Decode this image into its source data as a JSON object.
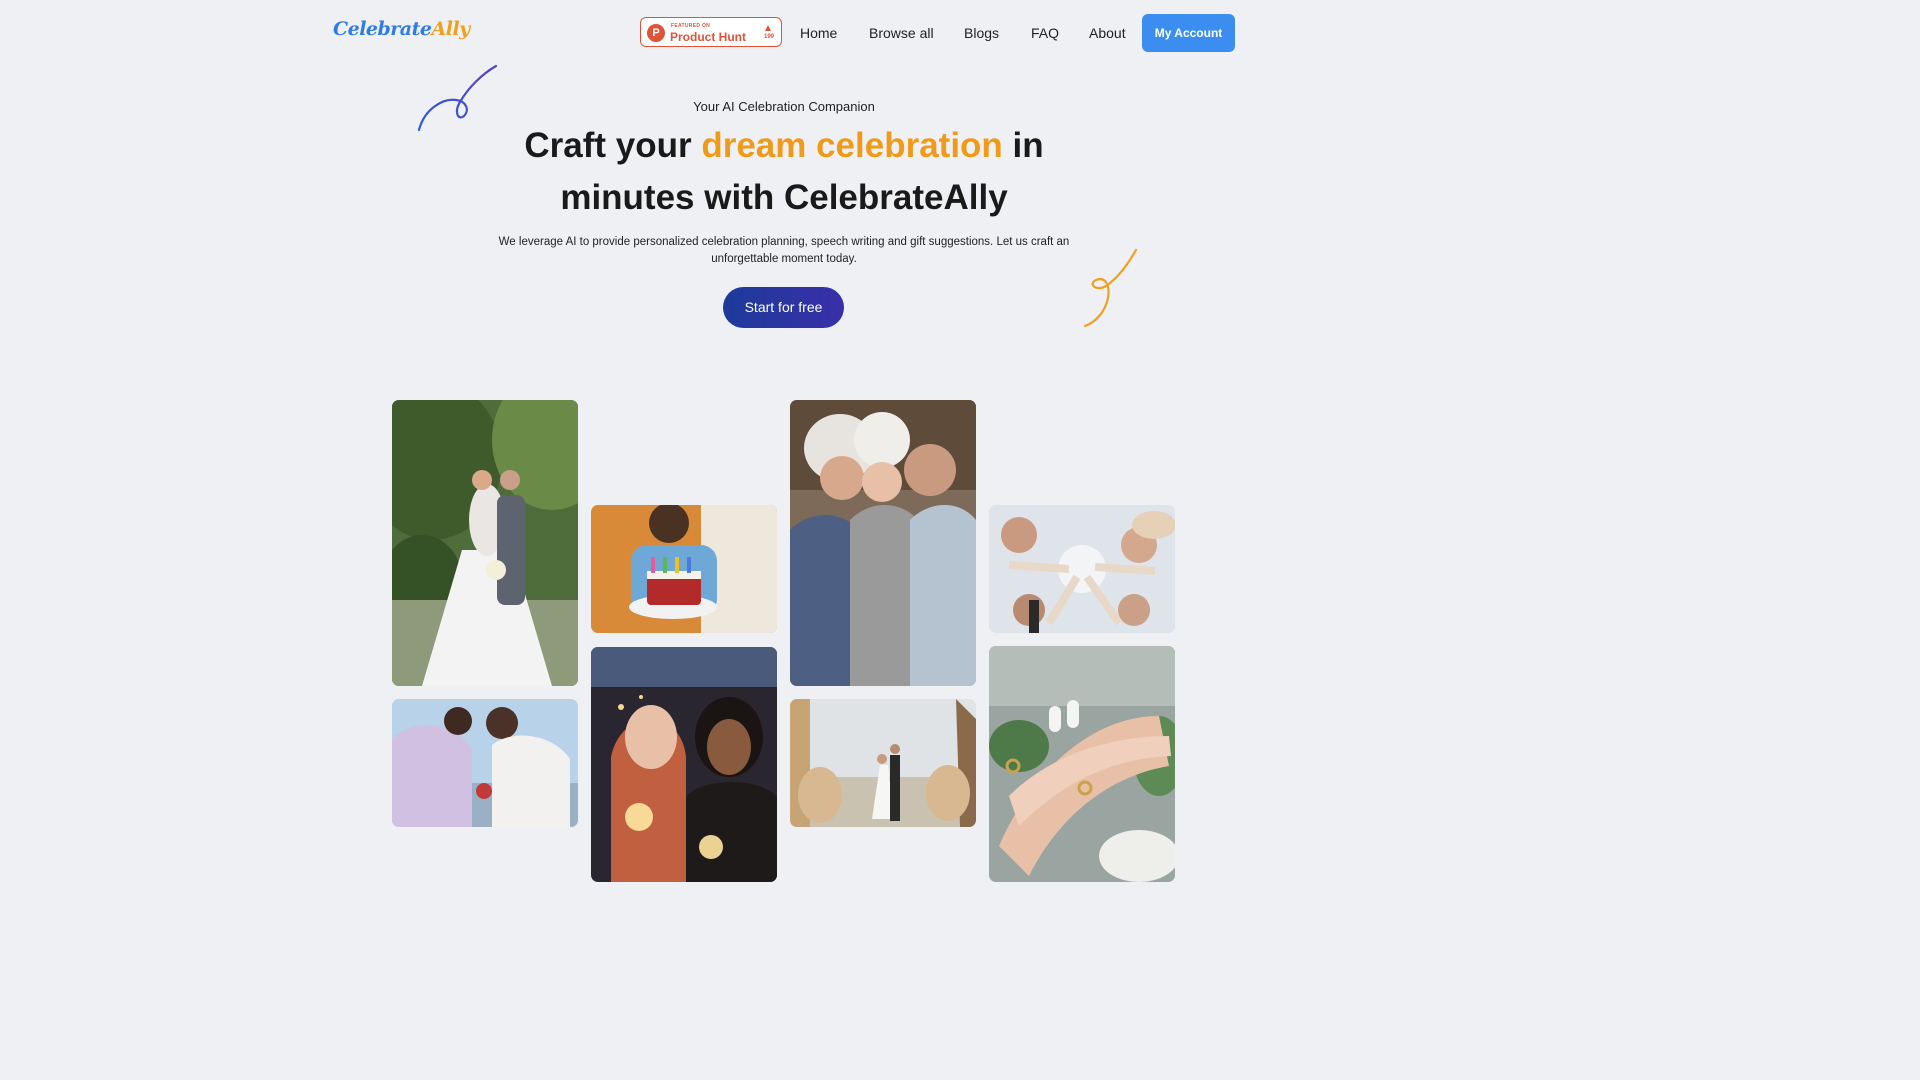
{
  "header": {
    "logo_part1": "Celebrate",
    "logo_part2": "Ally",
    "product_hunt": {
      "small_text": "FEATURED ON",
      "name": "Product Hunt",
      "logo_letter": "P",
      "upvotes": "199"
    },
    "nav": {
      "home": "Home",
      "browse_all": "Browse all",
      "blogs": "Blogs",
      "faq": "FAQ",
      "about": "About"
    },
    "account_button": "My Account"
  },
  "hero": {
    "subtitle": "Your AI Celebration Companion",
    "headline_part1": "Craft your ",
    "headline_accent": "dream celebration",
    "headline_part2": " in",
    "headline_line2": "minutes with CelebrateAlly",
    "description": "We leverage AI to provide personalized celebration planning, speech writing and gift suggestions. Let us craft an unforgettable moment today.",
    "cta": "Start for free"
  },
  "gallery": {
    "photos": [
      "wedding couple in garden",
      "birthday cake with candles",
      "family with child in winter",
      "friends toasting champagne",
      "couple kissing outdoors",
      "friends with sparklers",
      "wedding couple by the sea",
      "hands with wedding rings"
    ]
  },
  "colors": {
    "accent_orange": "#f09a1a",
    "account_blue": "#3b8ef0",
    "cta_navy": "#1d3a9a",
    "product_hunt_red": "#e0533a",
    "background": "#eef0f4"
  }
}
